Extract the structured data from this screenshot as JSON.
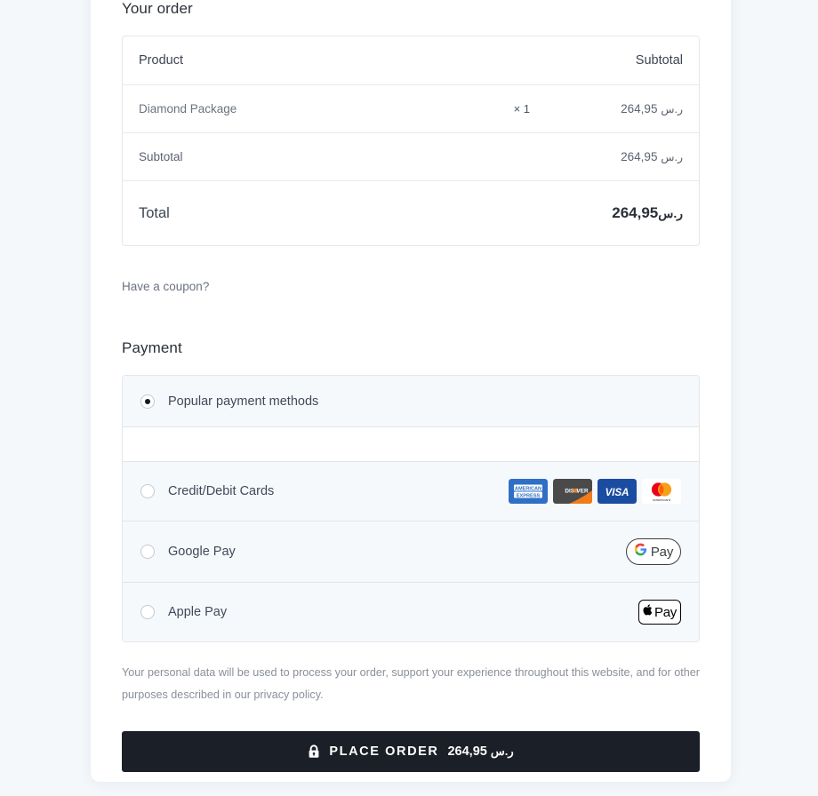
{
  "order": {
    "heading": "Your order",
    "columns": {
      "product": "Product",
      "subtotal": "Subtotal"
    },
    "items": [
      {
        "name": "Diamond Package",
        "quantity": "× 1",
        "amount": "264,95",
        "currency": "ر.س"
      }
    ],
    "subtotal": {
      "label": "Subtotal",
      "amount": "264,95",
      "currency": "ر.س"
    },
    "total": {
      "label": "Total",
      "amount": "264,95",
      "currency": "ر.س"
    }
  },
  "coupon": {
    "text": "Have a coupon?"
  },
  "payment": {
    "heading": "Payment",
    "methods": [
      {
        "label": "Popular payment methods",
        "selected": true,
        "badge": "none"
      },
      {
        "label": "Credit/Debit Cards",
        "selected": false,
        "badge": "cards"
      },
      {
        "label": "Google Pay",
        "selected": false,
        "badge": "gpay"
      },
      {
        "label": "Apple Pay",
        "selected": false,
        "badge": "applepay"
      }
    ],
    "card_brands": [
      "american-express",
      "discover",
      "visa",
      "mastercard"
    ],
    "gpay_label": "Pay",
    "applepay_label": "Pay"
  },
  "privacy": {
    "text": "Your personal data will be used to process your order, support your experience throughout this website, and for other purposes described in our ",
    "link": "privacy policy",
    "tail": "."
  },
  "place_order": {
    "label": "PLACE ORDER",
    "amount": "264,95",
    "currency": "ر.س",
    "icon": "lock-icon"
  },
  "colors": {
    "page_background": "#f4f8fb",
    "card_background": "#ffffff",
    "button_background": "#1b1f27",
    "row_background": "#f6f9fc",
    "border": "#e4e7eb",
    "text_primary": "#2b3038",
    "text_muted": "#6b7280"
  }
}
